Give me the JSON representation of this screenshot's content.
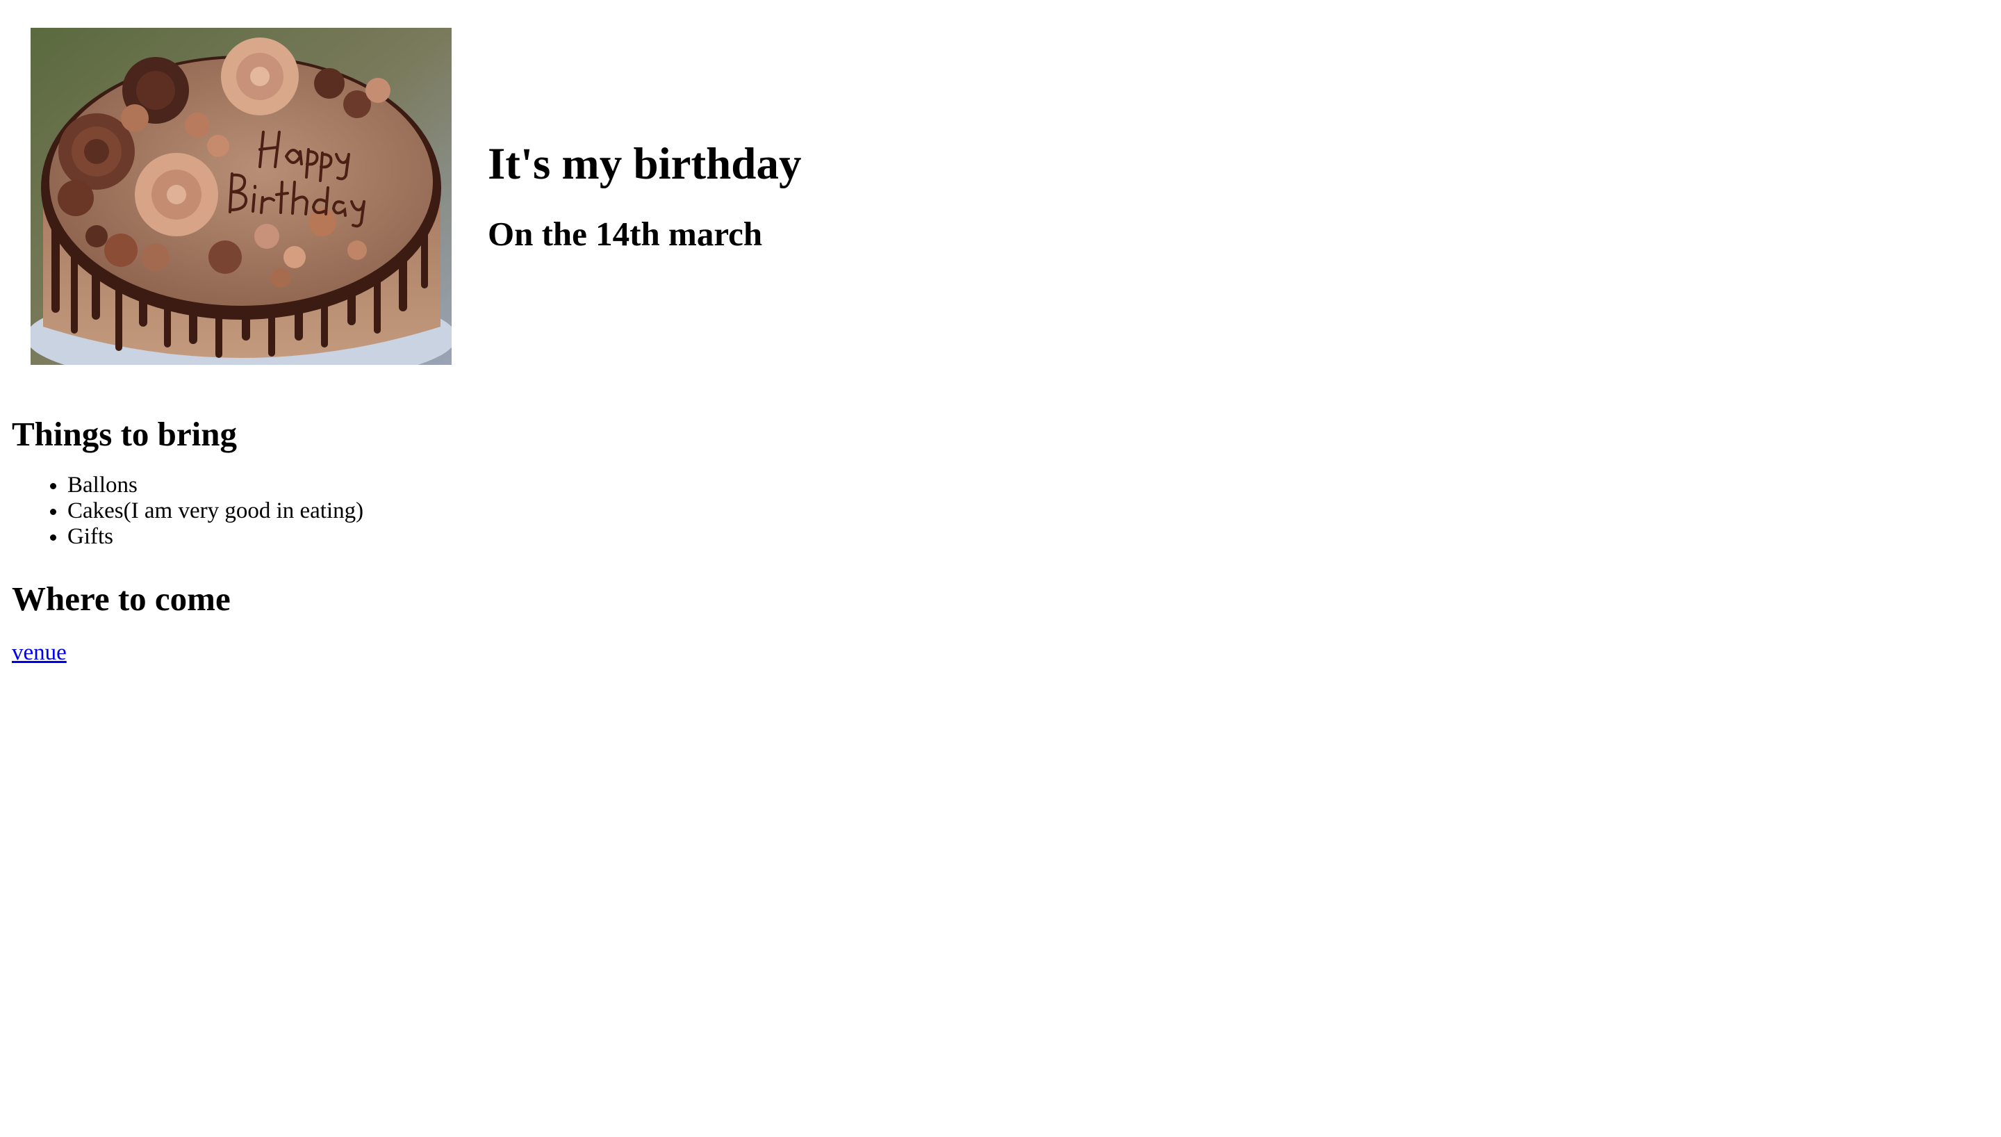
{
  "header": {
    "title": "It's my birthday",
    "subtitle": "On the 14th march",
    "cake_image": {
      "icon": "birthday-cake-image",
      "inscription": "Happy Birthday"
    }
  },
  "bring": {
    "heading": "Things to bring",
    "items": [
      "Ballons",
      "Cakes(I am very good in eating)",
      "Gifts"
    ]
  },
  "where": {
    "heading": "Where to come",
    "link_label": "venue"
  },
  "colors": {
    "link": "#0000ee",
    "text": "#000000",
    "background": "#ffffff",
    "cake_frosting": "#9b6f57",
    "chocolate_drip": "#3b1b12"
  }
}
